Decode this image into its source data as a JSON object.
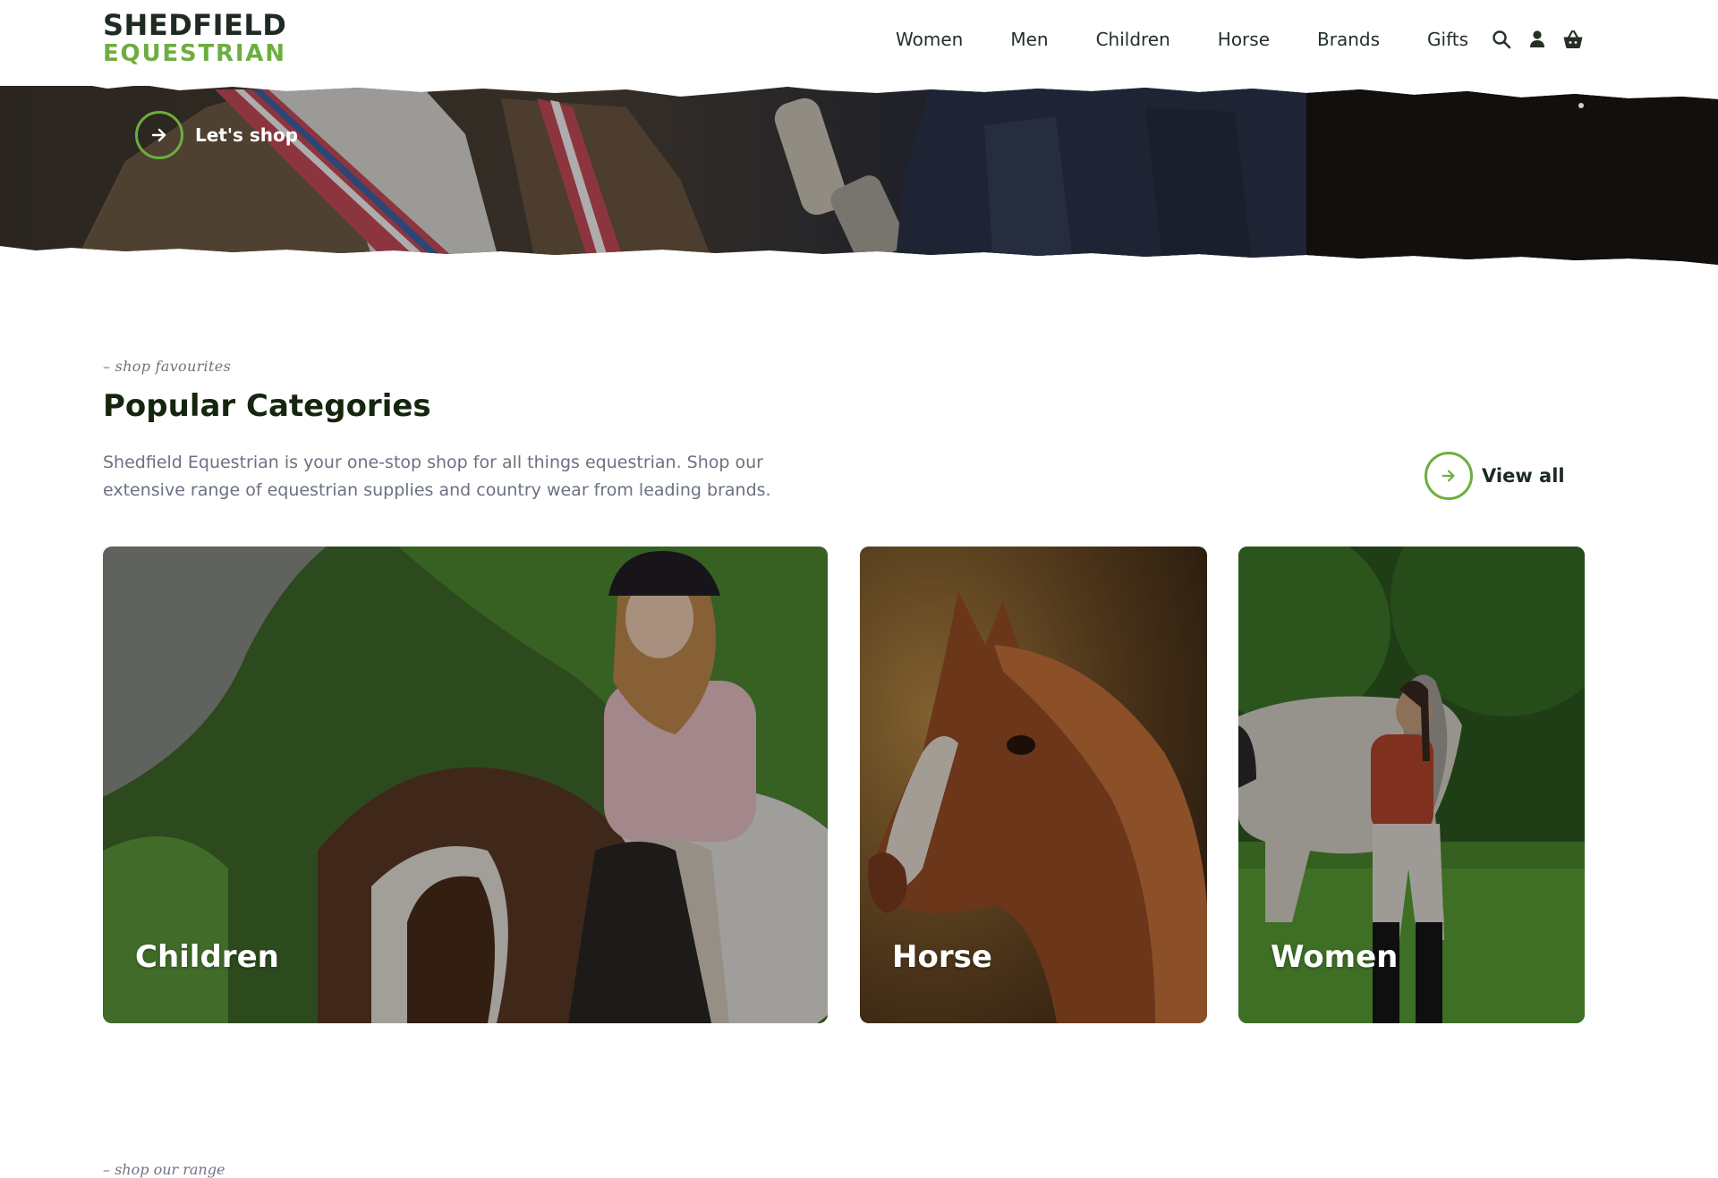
{
  "brand": {
    "line1": "SHEDFIELD",
    "line2": "EQUESTRIAN",
    "dark_color": "#1f2a22",
    "accent_color": "#6cae3f"
  },
  "nav": {
    "items": [
      "Women",
      "Men",
      "Children",
      "Horse",
      "Brands",
      "Gifts"
    ],
    "icons": [
      "search-icon",
      "account-icon",
      "basket-icon"
    ]
  },
  "hero": {
    "cta_label": "Let's shop"
  },
  "popular": {
    "eyebrow": "– shop favourites",
    "title": "Popular Categories",
    "description": "Shedfield Equestrian is your one-stop shop for all things equestrian. Shop our extensive range of equestrian supplies and country wear from leading brands.",
    "view_all_label": "View all",
    "cards": [
      {
        "label": "Children"
      },
      {
        "label": "Horse"
      },
      {
        "label": "Women"
      }
    ]
  },
  "next_section": {
    "eyebrow": "– shop our range"
  }
}
